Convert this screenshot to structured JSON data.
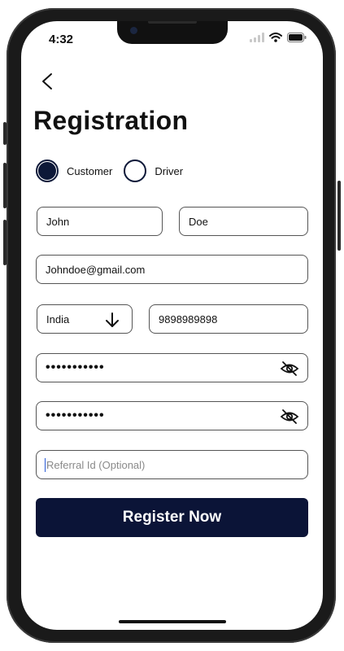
{
  "status_bar": {
    "time": "4:32"
  },
  "header": {
    "title": "Registration"
  },
  "role": {
    "options": [
      {
        "label": "Customer",
        "selected": true
      },
      {
        "label": "Driver",
        "selected": false
      }
    ]
  },
  "form": {
    "first_name": "John",
    "last_name": "Doe",
    "email": "Johndoe@gmail.com",
    "country": "India",
    "phone": "9898989898",
    "password": "•••••••••••",
    "confirm_password": "•••••••••••",
    "referral_placeholder": "Referral Id (Optional)"
  },
  "actions": {
    "register_label": "Register Now"
  },
  "colors": {
    "primary": "#0b1437",
    "text": "#111111",
    "border": "#555555"
  },
  "icons": [
    "back-arrow-icon",
    "signal-icon",
    "wifi-icon",
    "battery-icon",
    "arrow-down-icon",
    "eye-off-icon"
  ]
}
